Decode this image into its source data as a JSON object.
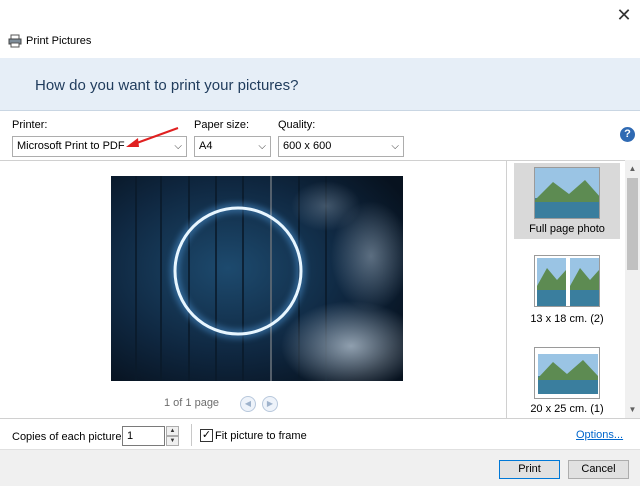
{
  "window": {
    "title": "Print Pictures"
  },
  "banner": {
    "heading": "How do you want to print your pictures?"
  },
  "printer": {
    "label": "Printer:",
    "value": "Microsoft Print to PDF"
  },
  "paper_size": {
    "label": "Paper size:",
    "value": "A4"
  },
  "quality": {
    "label": "Quality:",
    "value": "600 x 600"
  },
  "preview": {
    "page_info": "1 of 1 page"
  },
  "layouts": [
    {
      "label": "Full page photo",
      "selected": true
    },
    {
      "label": "13 x 18 cm. (2)",
      "selected": false
    },
    {
      "label": "20 x 25 cm. (1)",
      "selected": false
    }
  ],
  "footer": {
    "copies_label": "Copies of each picture:",
    "copies_value": "1",
    "fit_label": "Fit picture to frame",
    "fit_checked": true,
    "options_link": "Options...",
    "print_button": "Print",
    "cancel_button": "Cancel"
  },
  "colors": {
    "banner_bg": "#e6eef7",
    "accent": "#0078d7",
    "link": "#0066cc",
    "annotation_arrow": "#e02020"
  }
}
